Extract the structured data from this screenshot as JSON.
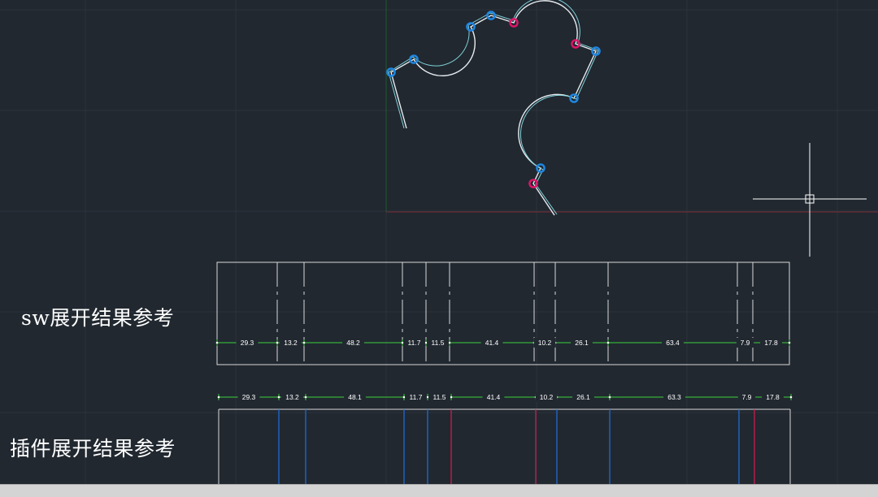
{
  "captions": {
    "sw_result": "sw展开结果参考",
    "plugin_result": "插件展开结果参考"
  },
  "colors": {
    "background": "#212830",
    "grid": "#2b323c",
    "profile_line": "#e6ecef",
    "profile_inner": "#7fd0d8",
    "blue_marker": "#1e88e5",
    "magenta_marker": "#e0156b",
    "dimension": "#3ccf3c",
    "blue_bend": "#1f6fe0",
    "red_bend": "#d81b50",
    "axis_red": "#7a2a35",
    "axis_green": "#1f5a2b"
  },
  "profile_markers": [
    {
      "type": "blue"
    },
    {
      "type": "blue"
    },
    {
      "type": "blue"
    },
    {
      "type": "blue"
    },
    {
      "type": "magenta"
    },
    {
      "type": "magenta"
    },
    {
      "type": "blue"
    },
    {
      "type": "blue"
    },
    {
      "type": "blue"
    },
    {
      "type": "magenta"
    }
  ],
  "sw_dimensions": [
    "29.3",
    "13.2",
    "48.2",
    "11.7",
    "11.5",
    "41.4",
    "10.2",
    "26.1",
    "63.4",
    "7.9",
    "17.8"
  ],
  "plugin_dimensions": [
    "29.3",
    "13.2",
    "48.1",
    "11.7",
    "11.5",
    "41.4",
    "10.2",
    "26.1",
    "63.3",
    "7.9",
    "17.8"
  ],
  "plugin_bend_colors": [
    "blue",
    "blue",
    "blue",
    "blue",
    "red",
    "red",
    "blue",
    "blue",
    "blue",
    "red"
  ],
  "crosshair_icon": "crosshair-cursor-icon"
}
